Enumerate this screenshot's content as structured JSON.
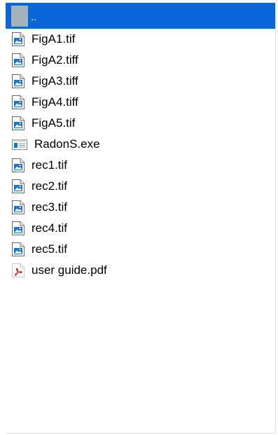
{
  "file_list": {
    "parent": {
      "label": "..",
      "icon": "folder-up-icon"
    },
    "items": [
      {
        "label": "FigA1.tif",
        "icon": "image-file-icon"
      },
      {
        "label": "FigA2.tiff",
        "icon": "image-file-icon"
      },
      {
        "label": "FigA3.tiff",
        "icon": "image-file-icon"
      },
      {
        "label": "FigA4.tiff",
        "icon": "image-file-icon"
      },
      {
        "label": "FigA5.tif",
        "icon": "image-file-icon"
      },
      {
        "label": "RadonS.exe",
        "icon": "executable-file-icon"
      },
      {
        "label": "rec1.tif",
        "icon": "image-file-icon"
      },
      {
        "label": "rec2.tif",
        "icon": "image-file-icon"
      },
      {
        "label": "rec3.tif",
        "icon": "image-file-icon"
      },
      {
        "label": "rec4.tif",
        "icon": "image-file-icon"
      },
      {
        "label": "rec5.tif",
        "icon": "image-file-icon"
      },
      {
        "label": "user guide.pdf",
        "icon": "pdf-file-icon"
      }
    ]
  },
  "colors": {
    "selection": "#0966d9",
    "parent_icon": "#a6b2bb",
    "image_icon_accent": "#1e73c8",
    "pdf_accent": "#d9352a"
  }
}
